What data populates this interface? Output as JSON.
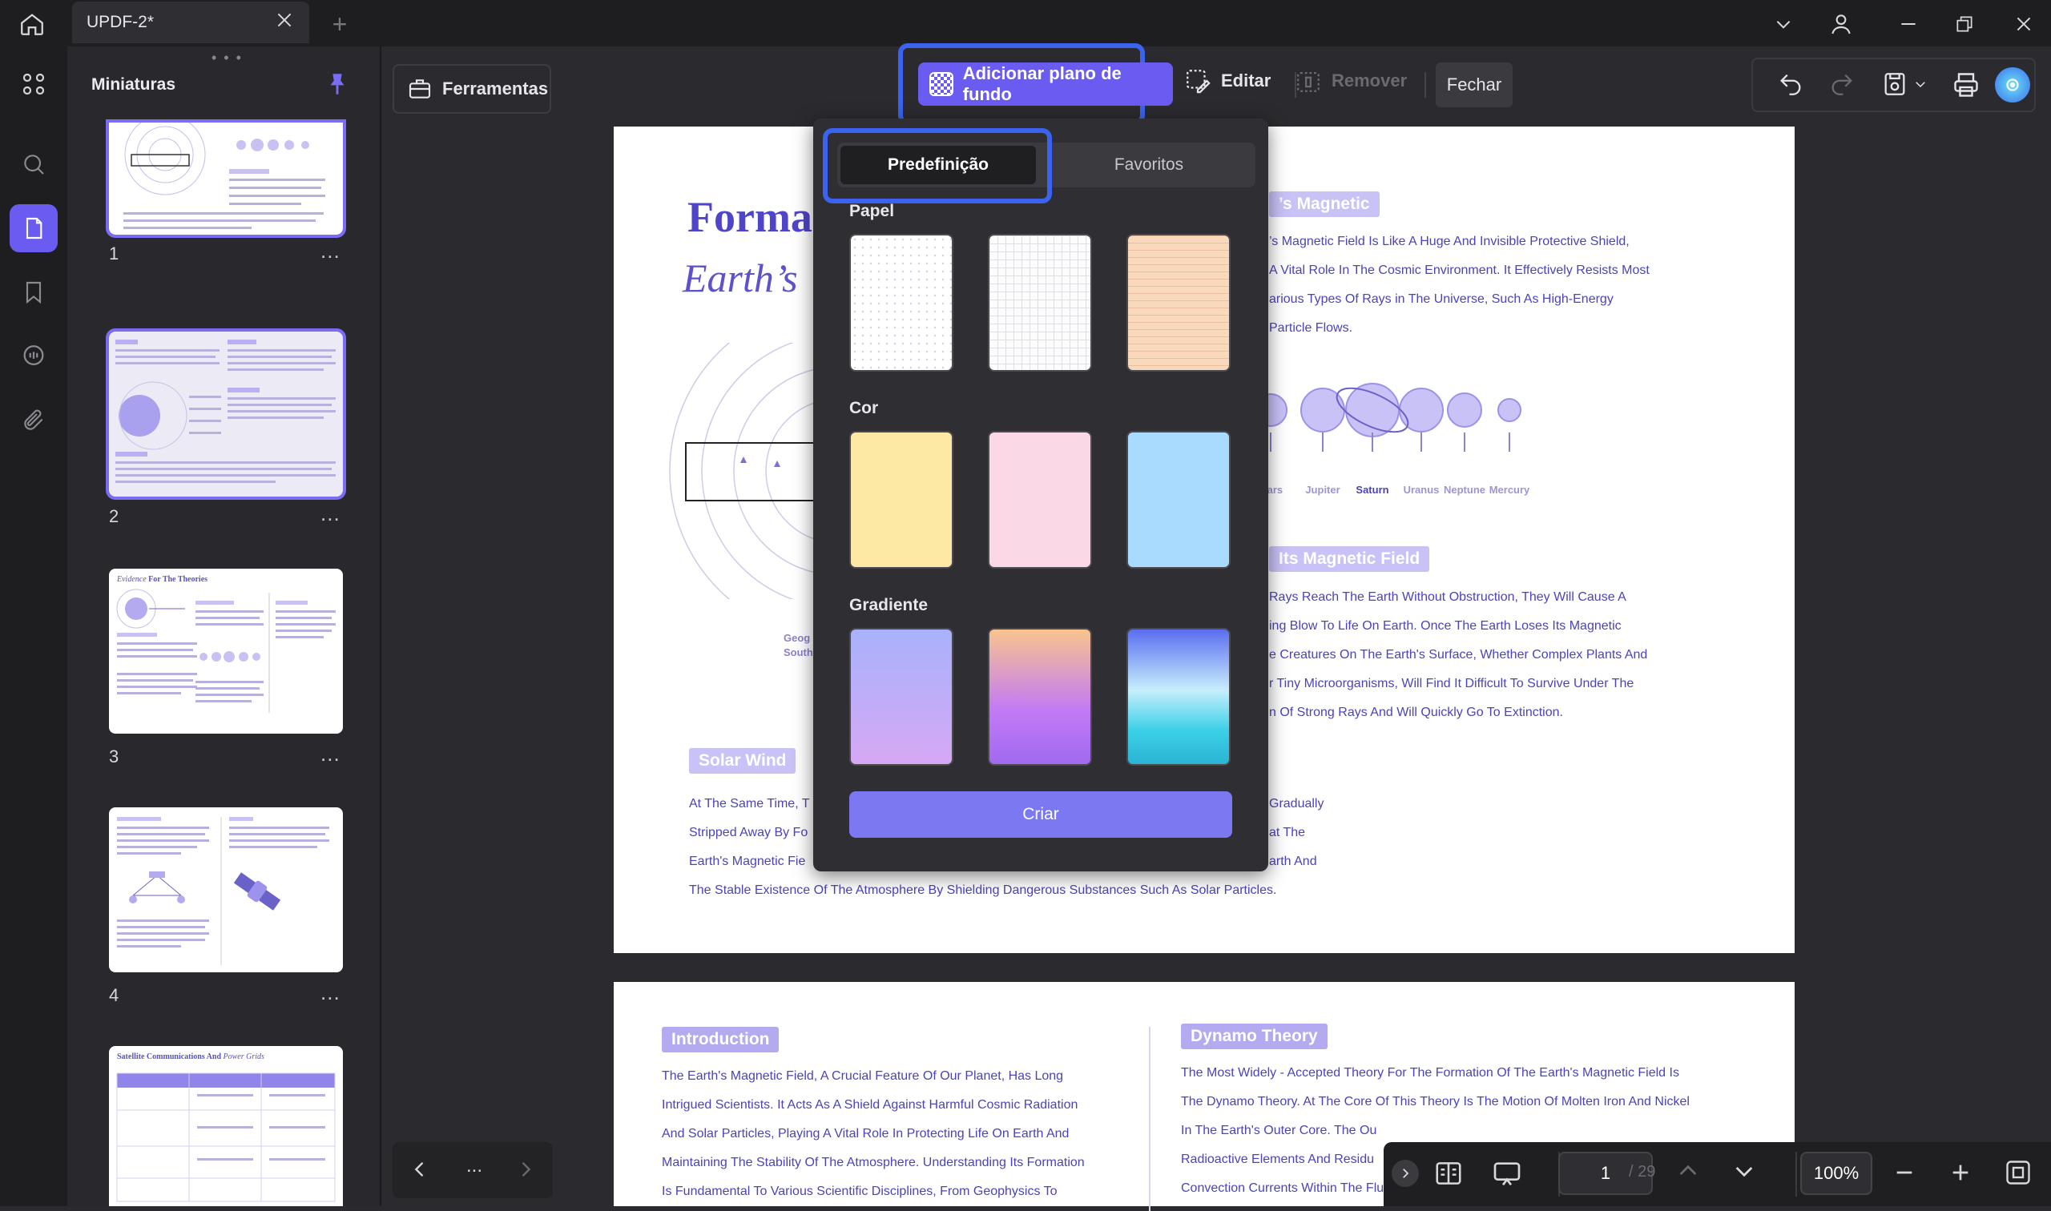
{
  "window": {
    "tab_title": "UPDF-2*",
    "new_tab_label": "+"
  },
  "sidebar": {
    "panel_title": "Miniaturas",
    "pages": [
      {
        "number": "1",
        "more": "..."
      },
      {
        "number": "2",
        "more": "..."
      },
      {
        "number": "3",
        "more": "..."
      },
      {
        "number": "4",
        "more": "..."
      }
    ],
    "thumb3_title_a": "Evidence",
    "thumb3_title_b": " For The Theories",
    "thumb5_title_a": "Satellite Communications And",
    "thumb5_title_b": " Power Grids"
  },
  "toolbar": {
    "tools_label": "Ferramentas",
    "add_background_label": "Adicionar plano de fundo",
    "edit_label": "Editar",
    "remove_label": "Remover",
    "close_label": "Fechar"
  },
  "popup": {
    "tab_preset": "Predefinição",
    "tab_favorites": "Favoritos",
    "section_paper": "Papel",
    "section_color": "Cor",
    "section_gradient": "Gradiente",
    "create_label": "Criar"
  },
  "document": {
    "title_line1": "Forma",
    "title_line2": "Earth’s",
    "tag_magnetic": "’s Magnetic",
    "magnetic_lines": [
      "’s Magnetic Field Is Like A Huge And Invisible Protective Shield,",
      "A Vital Role In The Cosmic Environment. It Effectively Resists Most",
      "arious Types Of Rays in The Universe, Such As High-Energy",
      "Particle Flows."
    ],
    "planets": [
      "Mars",
      "Jupiter",
      "Saturn",
      "Uranus",
      "Neptune",
      "Mercury"
    ],
    "tag_field": "Its Magnetic Field",
    "field_lines": [
      "Rays Reach The Earth Without Obstruction, They Will Cause A",
      "ing Blow To Life On Earth. Once The Earth Loses Its Magnetic",
      "e Creatures On The Earth's Surface, Whether Complex Plants And",
      "r Tiny Microorganisms, Will Find It Difficult To Survive Under The",
      "n Of Strong Rays And Will Quickly Go To Extinction."
    ],
    "geo_label_1": "Geog",
    "geo_label_2": "South",
    "tag_solar": "Solar Wind",
    "solar_left": [
      "At The Same Time, T",
      "Stripped Away By Fo",
      "Earth's Magnetic Fie"
    ],
    "solar_right": [
      "Gradually",
      "at The",
      "arth And"
    ],
    "solar_last": "The Stable Existence Of The Atmosphere By Shielding Dangerous Substances Such As Solar Particles.",
    "tag_intro": "Introduction",
    "intro_lines": [
      "The Earth's Magnetic Field, A Crucial Feature Of Our Planet, Has Long",
      "Intrigued Scientists. It Acts As A Shield Against Harmful Cosmic Radiation",
      "And Solar Particles, Playing A Vital Role In Protecting Life On Earth And",
      "Maintaining The Stability Of The Atmosphere. Understanding Its Formation",
      "Is Fundamental To Various Scientific Disciplines, From Geophysics To"
    ],
    "tag_dynamo": "Dynamo Theory",
    "dynamo_lines": [
      "The Most Widely - Accepted Theory For The Formation Of The Earth's Magnetic Field Is",
      "The Dynamo Theory. At The Core Of This Theory Is The Motion Of Molten Iron And Nickel",
      "In The Earth's Outer Core. The Ou",
      "Radioactive Elements And Residu",
      "Convection Currents Within The Fluid"
    ]
  },
  "bottombar": {
    "page_current": "1",
    "page_total": "/ 29",
    "zoom": "100%"
  },
  "navbar": {
    "dots": "..."
  },
  "colors": {
    "accent": "#7b6cf5",
    "highlight": "#3b63f0",
    "doc_text": "#4b44b8"
  }
}
